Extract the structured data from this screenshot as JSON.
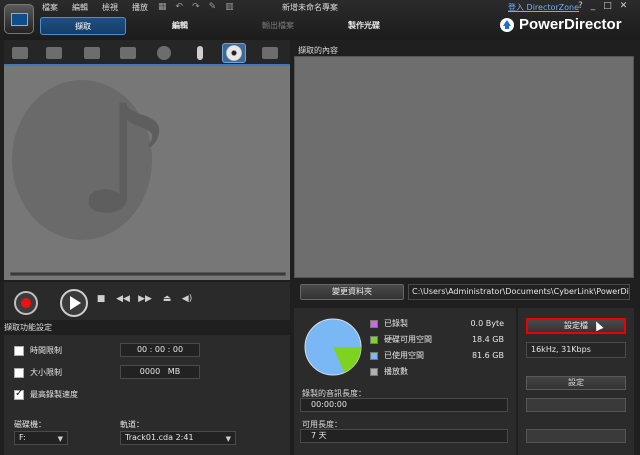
{
  "menu": [
    "檔案",
    "編輯",
    "檢視",
    "播放"
  ],
  "project_title": "新增未命名專案",
  "login_link": "登入 DirectorZone",
  "window_controls": [
    "?",
    "_",
    "□",
    "✕"
  ],
  "mode_tabs": {
    "capture": "擷取",
    "edit": "編輯",
    "output": "輸出檔案",
    "disc": "製作光碟"
  },
  "brand": "PowerDirector",
  "source_icons": [
    "capture-tv-icon",
    "camcorder-icon",
    "tv-icon",
    "digital-tv-icon",
    "webcam-icon",
    "microphone-icon",
    "audio-cd-icon",
    "dv-camera-icon"
  ],
  "captured_content_title": "擷取的內容",
  "change_folder_label": "變更資料夾",
  "folder_path": "C:\\Users\\Administrator\\Documents\\CyberLink\\PowerDire...\\",
  "capture_settings": {
    "header": "擷取功能設定",
    "time_limit_label": "時間限制",
    "time_limit_value": "00 : 00 : 00",
    "size_limit_label": "大小限制",
    "size_limit_value": "0000",
    "size_limit_unit": "MB",
    "max_speed_label": "最高錄製速度",
    "drive_label": "磁碟機：",
    "drive_value": "F:",
    "track_label": "軌道：",
    "track_value": "Track01.cda  2:41"
  },
  "disc_usage": {
    "items": [
      {
        "label": "已錄製",
        "value": "0.0 Byte",
        "color": "#c86be0"
      },
      {
        "label": "硬碟可用空間",
        "value": "18.4 GB",
        "color": "#7ed321"
      },
      {
        "label": "已使用空間",
        "value": "81.6 GB",
        "color": "#7ab8f5"
      },
      {
        "label": "播放數",
        "value": "",
        "color": "#b0b0b0"
      }
    ],
    "recorded_length_label": "錄製的音訊長度：",
    "recorded_length_value": "00:00:00",
    "available_length_label": "可用長度：",
    "available_length_value": "7 天"
  },
  "profile": {
    "button_label": "設定檔",
    "value": "16kHz,  31Kbps",
    "settings_label": "設定"
  }
}
